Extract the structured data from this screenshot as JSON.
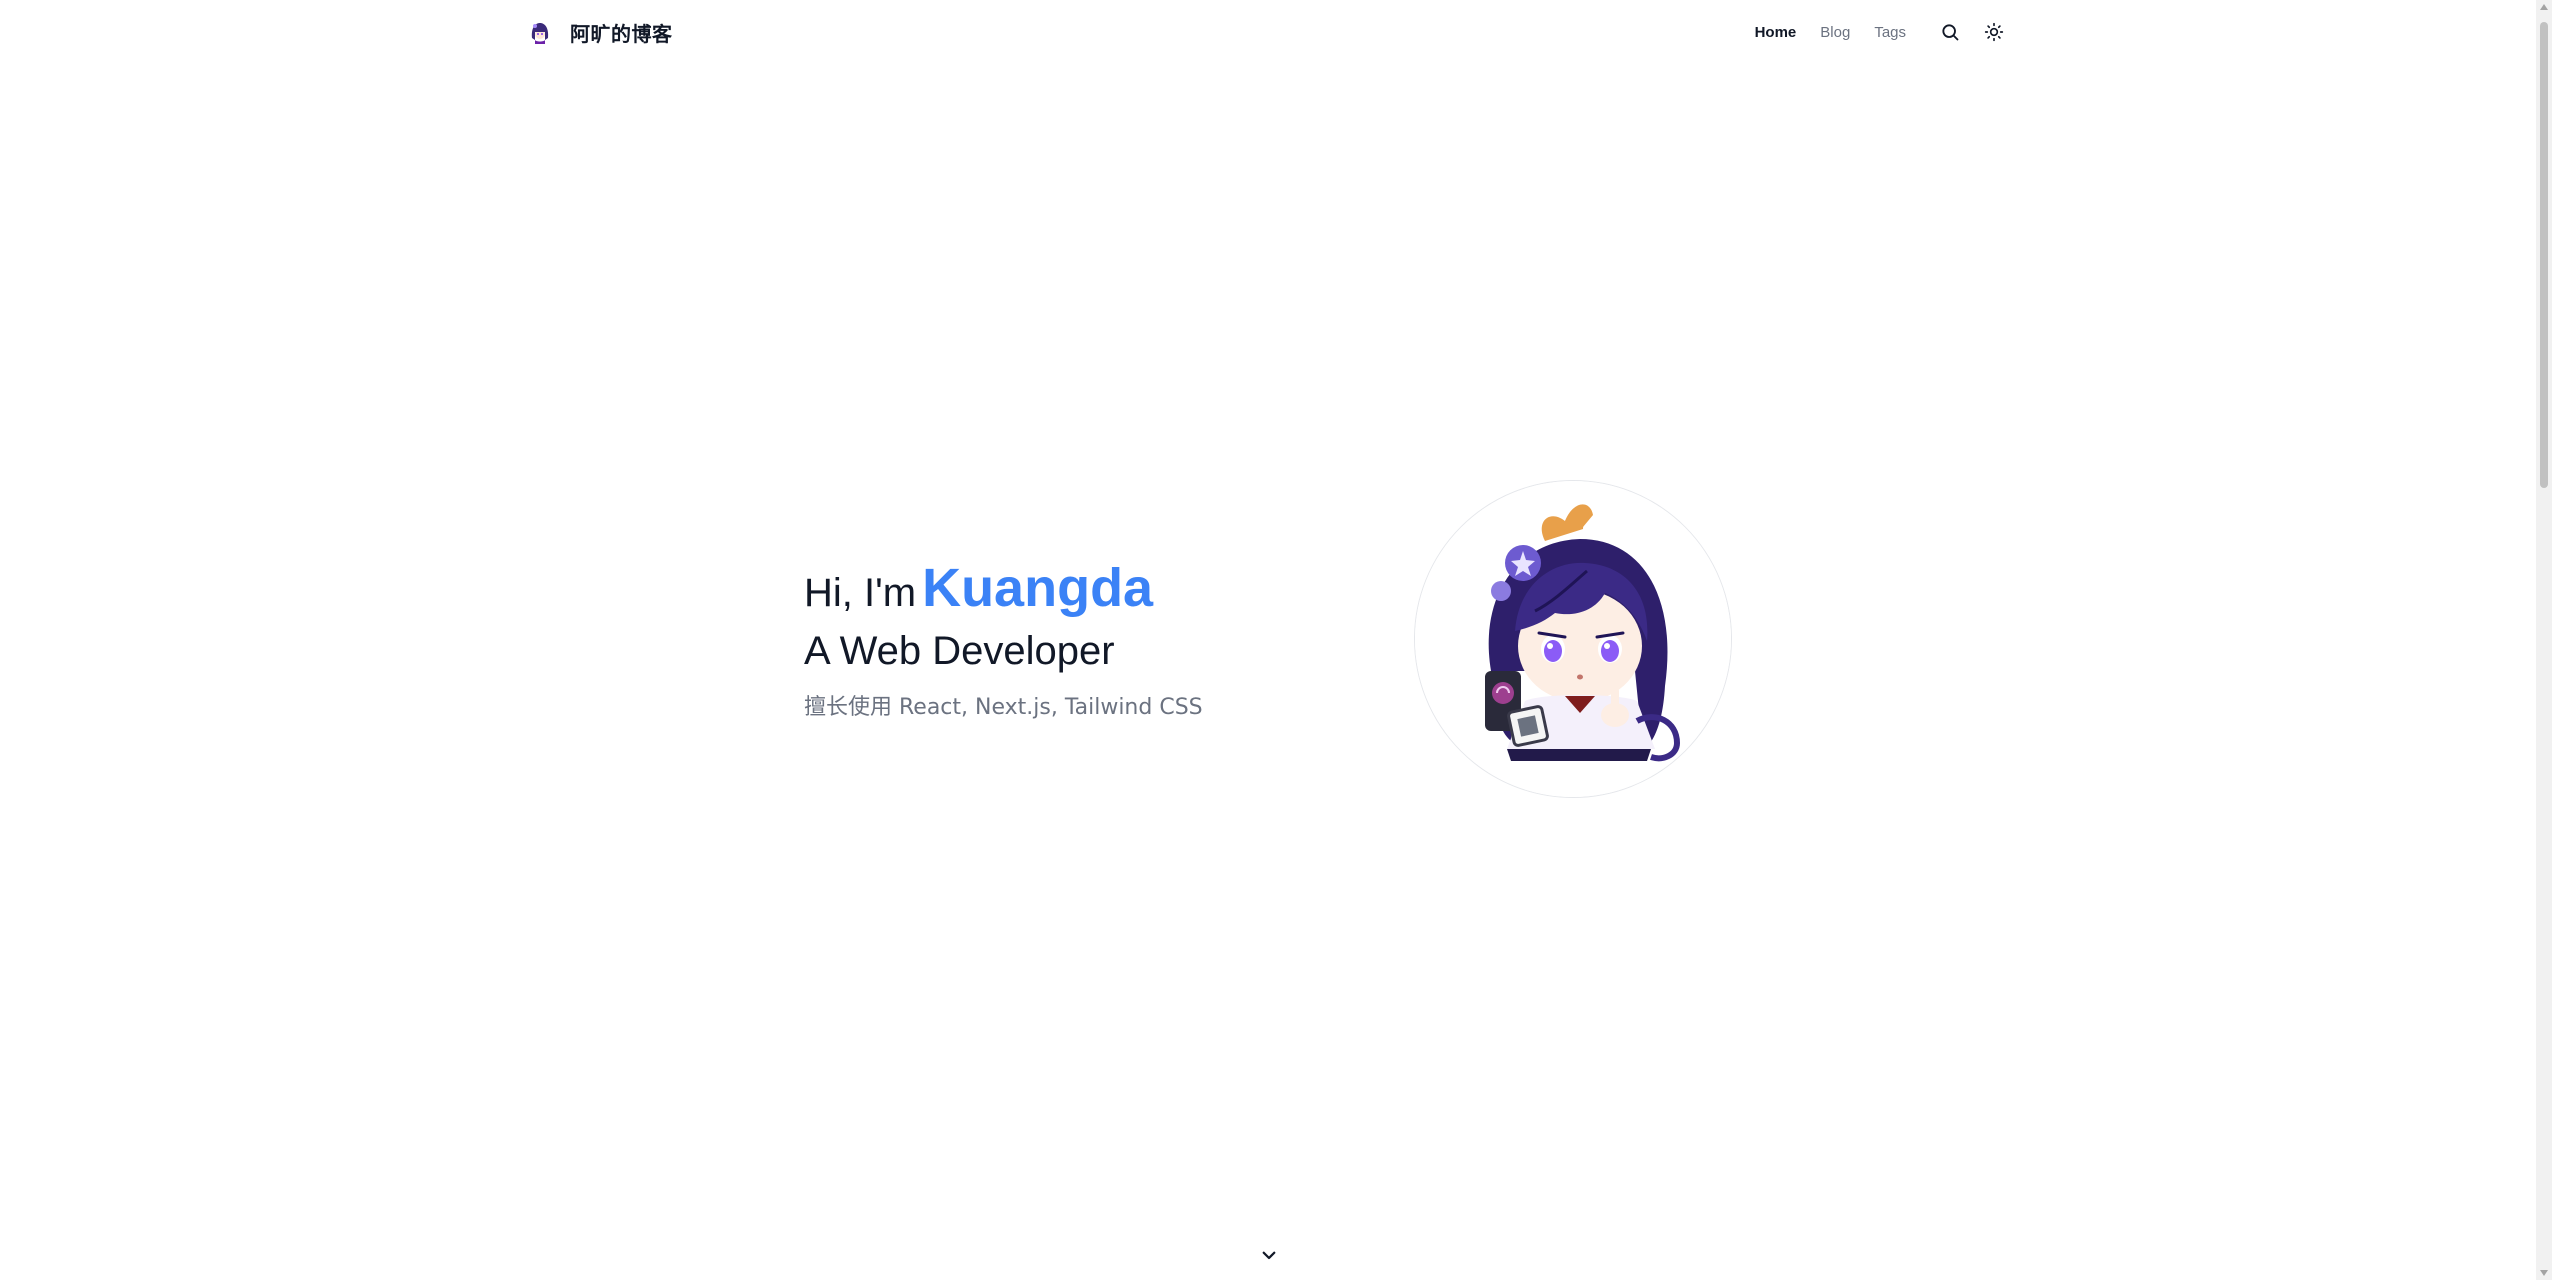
{
  "header": {
    "site_title": "阿旷的博客",
    "logo_icon": "avatar-icon",
    "nav": {
      "home": "Home",
      "blog": "Blog",
      "tags": "Tags"
    },
    "search_icon": "search-icon",
    "theme_icon": "sun-icon"
  },
  "hero": {
    "greeting": "Hi, I'm",
    "name": "Kuangda",
    "role": "A Web Developer",
    "skills": "擅长使用 React, Next.js, Tailwind CSS"
  },
  "scroll": {
    "icon": "chevron-down-icon"
  },
  "colors": {
    "accent": "#3b82f6",
    "text": "#111827",
    "muted": "#6b7280",
    "background": "#ffffff"
  }
}
